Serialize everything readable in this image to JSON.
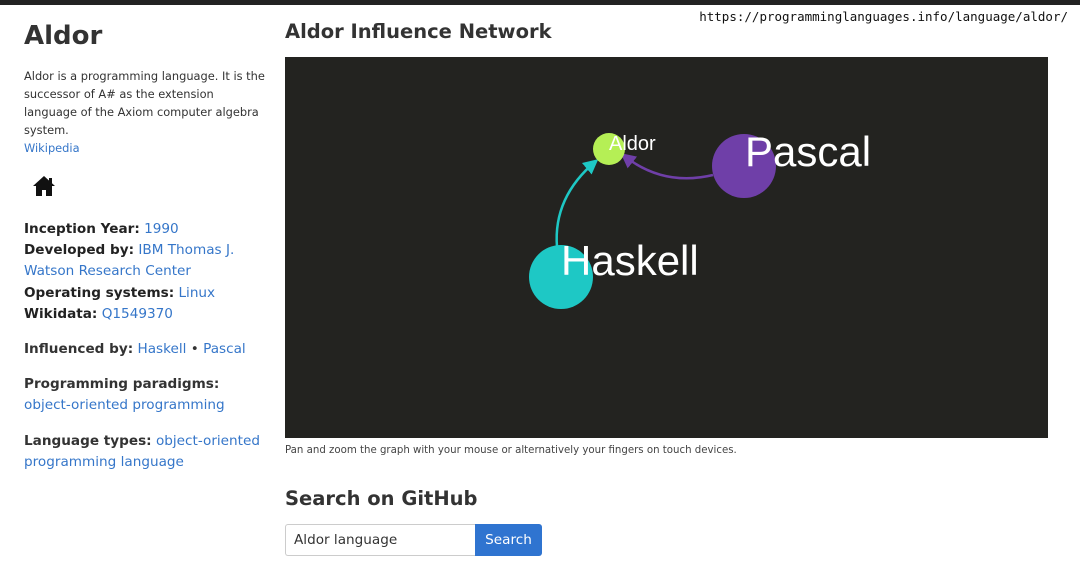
{
  "url": "https://programminglanguages.info/language/aldor/",
  "sidebar": {
    "title": "Aldor",
    "description": "Aldor is a programming language. It is the successor of A# as the extension language of the Axiom computer algebra system.",
    "description_link": "Wikipedia",
    "home_icon": "home-icon",
    "facts": {
      "inception_label": "Inception Year:",
      "inception_value": "1990",
      "developed_label": "Developed by:",
      "developed_value": "IBM Thomas J. Watson Research Center",
      "os_label": "Operating systems:",
      "os_value": "Linux",
      "wikidata_label": "Wikidata:",
      "wikidata_value": "Q1549370"
    },
    "influenced_label": "Influenced by:",
    "influenced": [
      "Haskell",
      "Pascal"
    ],
    "influenced_sep": "•",
    "paradigms_label": "Programming paradigms:",
    "paradigms_value": "object-oriented programming",
    "types_label": "Language types:",
    "types_value": "object-oriented programming language"
  },
  "main": {
    "network_title": "Aldor Influence Network",
    "graph": {
      "background": "#232320",
      "nodes": [
        {
          "label": "Aldor",
          "color": "#b5ef55"
        },
        {
          "label": "Pascal",
          "color": "#6f3fa8"
        },
        {
          "label": "Haskell",
          "color": "#1ec8c5"
        }
      ],
      "edges": [
        {
          "from": "Pascal",
          "to": "Aldor",
          "color": "#6f3fa8"
        },
        {
          "from": "Haskell",
          "to": "Aldor",
          "color": "#1ec8c5"
        }
      ]
    },
    "caption": "Pan and zoom the graph with your mouse or alternatively your fingers on touch devices.",
    "github_title": "Search on GitHub",
    "search_value": "Aldor language",
    "search_button": "Search"
  }
}
